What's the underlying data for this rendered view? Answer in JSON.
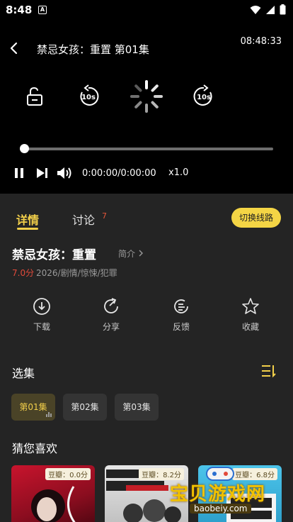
{
  "status_bar": {
    "time": "8:48",
    "app_badge": "A"
  },
  "player": {
    "title": "禁忌女孩：重置 第01集",
    "clock": "08:48:33",
    "current_time": "0:00:00",
    "time_separator": "/",
    "duration": "0:00:00",
    "speed": "x1.0",
    "progress": 0.0
  },
  "tabs": {
    "details": "详情",
    "discuss": "讨论",
    "discuss_count": "7",
    "switch_line": "切换线路"
  },
  "show": {
    "title": "禁忌女孩：重置",
    "intro": "简介",
    "rating": "7.0分",
    "meta": "2026/剧情/惊悚/犯罪"
  },
  "actions": [
    {
      "label": "下载",
      "icon": "download-icon"
    },
    {
      "label": "分享",
      "icon": "share-icon"
    },
    {
      "label": "反馈",
      "icon": "feedback-icon"
    },
    {
      "label": "收藏",
      "icon": "star-icon"
    }
  ],
  "episodes": {
    "title": "选集",
    "items": [
      "第01集",
      "第02集",
      "第03集"
    ],
    "active_index": 0
  },
  "recommend": {
    "title": "猜您喜欢",
    "cards": [
      {
        "tag": "豆瓣：0.0分",
        "color": "#b3122a"
      },
      {
        "tag": "豆瓣：8.2分",
        "color": "#d9d9d9"
      },
      {
        "tag": "豆瓣：6.8分",
        "color": "#3ab0d8"
      }
    ]
  },
  "watermark": {
    "text": "宝贝游戏网",
    "url": "baobeiy.com"
  },
  "colors": {
    "accent": "#f2cf4a",
    "rating": "#e24a3b",
    "panel": "#242424"
  }
}
